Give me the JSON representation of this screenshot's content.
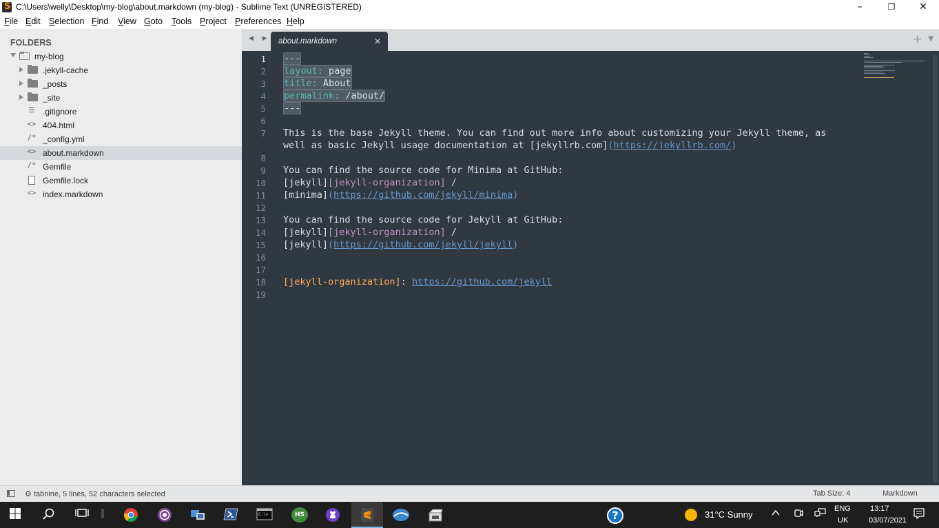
{
  "window": {
    "title": "C:\\Users\\welly\\Desktop\\my-blog\\about.markdown (my-blog) - Sublime Text (UNREGISTERED)",
    "minimize_glyph": "–",
    "maximize_glyph": "❐",
    "close_glyph": "✕"
  },
  "menu": [
    "File",
    "Edit",
    "Selection",
    "Find",
    "View",
    "Goto",
    "Tools",
    "Project",
    "Preferences",
    "Help"
  ],
  "sidebar": {
    "header": "FOLDERS",
    "root": "my-blog",
    "items": [
      {
        "label": ".jekyll-cache",
        "type": "folder"
      },
      {
        "label": "_posts",
        "type": "folder"
      },
      {
        "label": "_site",
        "type": "folder"
      },
      {
        "label": ".gitignore",
        "type": "file",
        "glyph": "☰"
      },
      {
        "label": "404.html",
        "type": "file",
        "glyph": "<>"
      },
      {
        "label": "_config.yml",
        "type": "file",
        "glyph": "/*"
      },
      {
        "label": "about.markdown",
        "type": "file",
        "glyph": "<>",
        "selected": true
      },
      {
        "label": "Gemfile",
        "type": "file",
        "glyph": "/*"
      },
      {
        "label": "Gemfile.lock",
        "type": "file",
        "glyph": ""
      },
      {
        "label": "index.markdown",
        "type": "file",
        "glyph": "<>"
      }
    ]
  },
  "tabs": {
    "nav": "◀ ▶",
    "active": "about.markdown",
    "close": "✕",
    "plus": "+",
    "dropdown": "▼"
  },
  "editor": {
    "line_numbers": [
      "1",
      "2",
      "3",
      "4",
      "5",
      "6",
      "7",
      "8",
      "9",
      "10",
      "11",
      "12",
      "13",
      "14",
      "15",
      "16",
      "17",
      "18",
      "19"
    ],
    "lines": {
      "l1": "---",
      "l2_key": "layout:",
      "l2_val": " page",
      "l3_key": "title:",
      "l3_val": " About",
      "l4_key": "permalink:",
      "l4_val": " /about/",
      "l5": "---",
      "l7": "This is the base Jekyll theme. You can find out more info about customizing your Jekyll theme, as",
      "l7b_text": "well as basic Jekyll usage documentation at [jekyllrb.com]",
      "l7b_open": "(",
      "l7b_url": "https://jekyllrb.com/",
      "l7b_close": ")",
      "l9": "You can find the source code for Minima at GitHub:",
      "l10_a": "[jekyll]",
      "l10_b": "[jekyll-organization]",
      "l10_c": " /",
      "l11_a": "[minima]",
      "l11_open": "(",
      "l11_url": "https://github.com/jekyll/minima",
      "l11_close": ")",
      "l13": "You can find the source code for Jekyll at GitHub:",
      "l14_a": "[jekyll]",
      "l14_b": "[jekyll-organization]",
      "l14_c": " /",
      "l15_a": "[jekyll]",
      "l15_open": "(",
      "l15_url": "https://github.com/jekyll/jekyll",
      "l15_close": ")",
      "l18_ref": "[jekyll-organization]",
      "l18_colon": ": ",
      "l18_url": "https://github.com/jekyll"
    }
  },
  "status": {
    "text": "⚙ tabnine, 5 lines, 52 characters selected",
    "tab_size": "Tab Size: 4",
    "syntax": "Markdown"
  },
  "taskbar": {
    "icons": [
      "windows-start-icon",
      "search-icon",
      "task-view-icon",
      "chrome-icon",
      "tor-browser-icon",
      "network-app-icon",
      "powershell-icon",
      "terminal-icon",
      "hs-app-icon",
      "github-desktop-icon",
      "sublime-text-icon",
      "pinta-icon",
      "virtualbox-icon",
      "help-icon"
    ],
    "hs_label": "HS",
    "help_glyph": "?",
    "weather": "31°C  Sunny",
    "lang_top": "ENG",
    "lang_bottom": "UK",
    "time": "13:17",
    "date": "03/07/2021",
    "notify_glyph": "🗨"
  },
  "colors": {
    "editor_bg": "#303841",
    "key": "#5fb4b4",
    "link_ref": "#c594c5",
    "ref_def": "#f9ae58",
    "url": "#6699cc"
  }
}
